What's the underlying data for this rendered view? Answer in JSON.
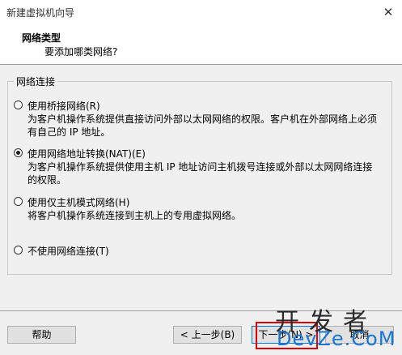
{
  "window": {
    "title": "新建虚拟机向导",
    "close_glyph": "✕"
  },
  "header": {
    "title": "网络类型",
    "subtitle": "要添加哪类网络?"
  },
  "group": {
    "label": "网络连接"
  },
  "options": [
    {
      "label": "使用桥接网络(R)",
      "description": "为客户机操作系统提供直接访问外部以太网网络的权限。客户机在外部网络上必须有自己的 IP 地址。",
      "checked": false
    },
    {
      "label": "使用网络地址转换(NAT)(E)",
      "description": "为客户机操作系统提供使用主机 IP 地址访问主机拨号连接或外部以太网网络连接的权限。",
      "checked": true
    },
    {
      "label": "使用仅主机模式网络(H)",
      "description": "将客户机操作系统连接到主机上的专用虚拟网络。",
      "checked": false
    },
    {
      "label": "不使用网络连接(T)",
      "description": "",
      "checked": false
    }
  ],
  "buttons": {
    "help": "帮助",
    "back": "< 上一步(B)",
    "next": "下一步(N) >",
    "cancel": "取消"
  },
  "watermark": {
    "line1": "开发者",
    "line2": "DevZe.CoM"
  },
  "colors": {
    "highlight": "#e00000",
    "watermark_blue": "#1976d2"
  }
}
